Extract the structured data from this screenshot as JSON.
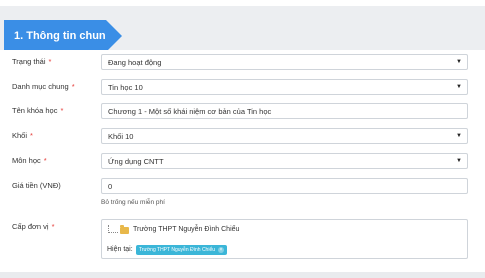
{
  "section": {
    "title": "1. Thông tin chung"
  },
  "form": {
    "status": {
      "label": "Trạng thái",
      "required": "*",
      "value": "Đang hoạt động"
    },
    "category": {
      "label": "Danh mục chung",
      "required": "*",
      "value": "Tin học 10"
    },
    "course_name": {
      "label": "Tên khóa học",
      "required": "*",
      "value": "Chương 1 - Một số khái niệm cơ bản của Tin học"
    },
    "grade": {
      "label": "Khối",
      "required": "*",
      "value": "Khối 10"
    },
    "subject": {
      "label": "Môn học",
      "required": "*",
      "value": "Ứng dụng CNTT"
    },
    "price": {
      "label": "Giá tiền (VNĐ)",
      "value": "0",
      "help": "Bỏ trống nếu miễn phí"
    },
    "unit_level": {
      "label": "Cấp đơn vị",
      "required": "*",
      "tree_item": "Trường THPT Nguyễn Đình Chiểu",
      "current_label": "Hiện tại:",
      "current_tag": "Trường THPT Nguyễn Đình Chiểu",
      "tag_remove": "×"
    }
  },
  "icons": {
    "dropdown_caret": "▼"
  },
  "colors": {
    "accent": "#3a8ee6",
    "tag": "#3bb6d8",
    "required": "#e53935",
    "header_band": "#eceef1"
  }
}
